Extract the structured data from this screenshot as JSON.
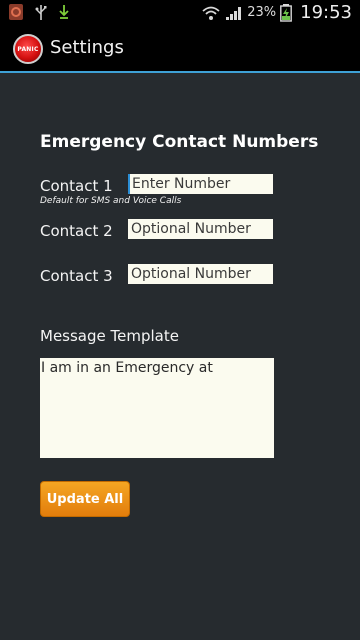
{
  "status_bar": {
    "battery_percent": "23%",
    "time": "19:53",
    "icons": [
      "notification-app-icon",
      "usb-icon",
      "download-icon",
      "wifi-icon",
      "signal-icon",
      "battery-charging-icon"
    ]
  },
  "action_bar": {
    "app_icon_text": "PANIC",
    "title": "Settings",
    "divider_color": "#3ea1d6"
  },
  "form": {
    "heading": "Emergency Contact Numbers",
    "contact1": {
      "label": "Contact 1",
      "placeholder": "Enter Number",
      "hint": "Default for SMS and Voice Calls"
    },
    "contact2": {
      "label": "Contact 2",
      "placeholder": "Optional Number"
    },
    "contact3": {
      "label": "Contact 3",
      "placeholder": "Optional Number"
    },
    "message": {
      "label": "Message Template",
      "value": "I am in an Emergency at"
    },
    "update_button": "Update All"
  },
  "colors": {
    "background": "#262b2f",
    "field_background": "#fbfbef",
    "button": "#f0960f",
    "accent": "#3ea1d6"
  }
}
